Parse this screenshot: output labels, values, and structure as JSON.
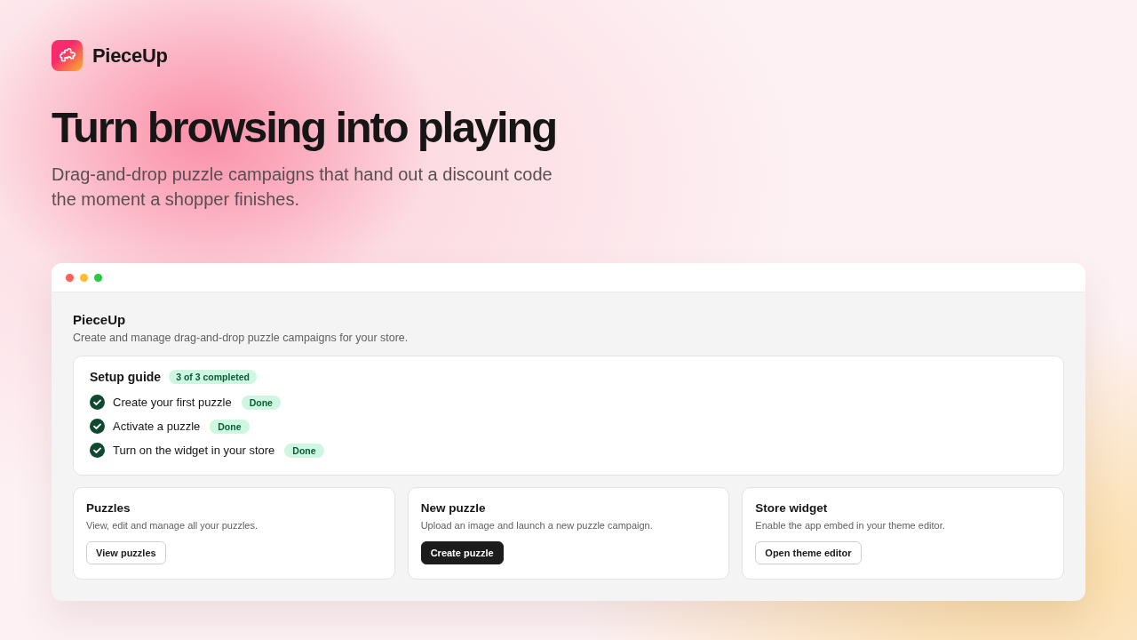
{
  "brand": {
    "name": "PieceUp"
  },
  "hero": {
    "title": "Turn browsing into playing",
    "subtitle": "Drag-and-drop puzzle campaigns that hand out a discount code the moment a shopper finishes."
  },
  "app": {
    "title": "PieceUp",
    "description": "Create and manage drag-and-drop puzzle campaigns for your store.",
    "setup_guide": {
      "title": "Setup guide",
      "progress": "3 of 3 completed",
      "steps": [
        {
          "label": "Create your first puzzle",
          "done": true,
          "badge": "Done"
        },
        {
          "label": "Activate a puzzle",
          "done": true,
          "badge": "Done"
        },
        {
          "label": "Turn on the widget in your store",
          "done": true,
          "badge": "Done"
        }
      ]
    },
    "cards": [
      {
        "title": "Puzzles",
        "description": "View, edit and manage all your puzzles.",
        "button": {
          "label": "View puzzles",
          "kind": "secondary"
        }
      },
      {
        "title": "New puzzle",
        "description": "Upload an image and launch a new puzzle campaign.",
        "button": {
          "label": "Create puzzle",
          "kind": "primary"
        }
      },
      {
        "title": "Store widget",
        "description": "Enable the app embed in your theme editor.",
        "button": {
          "label": "Open theme editor",
          "kind": "secondary"
        }
      }
    ]
  }
}
